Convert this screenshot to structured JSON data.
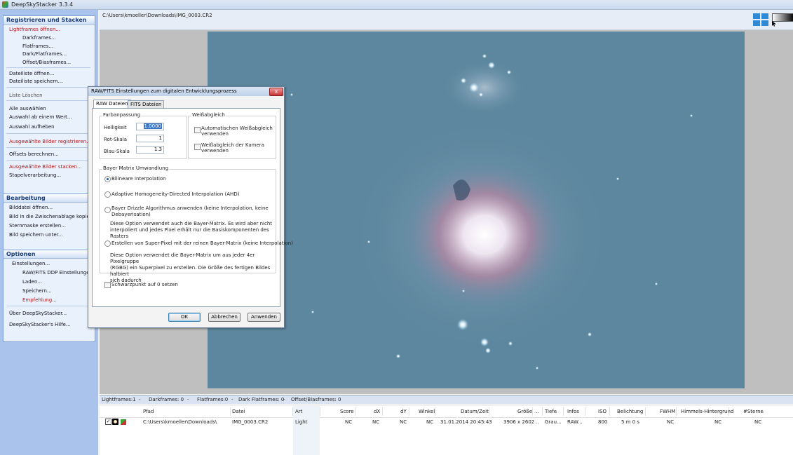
{
  "app": {
    "title": "DeepSkyStacker 3.3.4"
  },
  "sidebar": {
    "register": {
      "header": "Registrieren und Stacken",
      "items": [
        {
          "label": "Lightframes öffnen...",
          "style": "red"
        },
        {
          "label": "Darkframes...",
          "style": "sub"
        },
        {
          "label": "Flatframes...",
          "style": "sub"
        },
        {
          "label": "Dark/Flatframes...",
          "style": "sub"
        },
        {
          "label": "Offset/Biasframes...",
          "style": "sub"
        },
        {
          "label": "Dateiliste öffnen...",
          "style": "normal"
        },
        {
          "label": "Dateiliste speichern...",
          "style": "normal"
        },
        {
          "label": "Liste Löschen",
          "style": "gray"
        },
        {
          "label": "Alle auswählen",
          "style": "normal"
        },
        {
          "label": "Auswahl ab einem Wert...",
          "style": "normal"
        },
        {
          "label": "Auswahl aufheben",
          "style": "normal"
        },
        {
          "label": "Ausgewählte Bilder registrieren...",
          "style": "red"
        },
        {
          "label": "Offsets berechnen...",
          "style": "normal"
        },
        {
          "label": "Ausgewählte Bilder stacken...",
          "style": "red"
        },
        {
          "label": "Stapelverarbeitung...",
          "style": "normal"
        }
      ]
    },
    "edit": {
      "header": "Bearbeitung",
      "items": [
        {
          "label": "Bilddatei öffnen..."
        },
        {
          "label": "Bild in die Zwischenablage kopieren"
        },
        {
          "label": "Sternmaske erstellen..."
        },
        {
          "label": "Bild speichern unter..."
        }
      ]
    },
    "options": {
      "header": "Optionen",
      "items": [
        {
          "label": "Einstellungen...",
          "style": "normal"
        },
        {
          "label": "RAW/FITS DDP Einstellungen...",
          "style": "sub"
        },
        {
          "label": "Laden...",
          "style": "sub"
        },
        {
          "label": "Speichern...",
          "style": "sub"
        },
        {
          "label": "Empfehlung...",
          "style": "red"
        },
        {
          "label": "Über DeepSkyStacker...",
          "style": "normal"
        },
        {
          "label": "DeepSkyStacker's Hilfe...",
          "style": "normal"
        }
      ]
    }
  },
  "pathbar": {
    "path": "C:\\Users\\kmoeller\\Downloads\\IMG_0003.CR2"
  },
  "dialog": {
    "title": "RAW/FITS Einstellungen zum digitalen Entwicklungsprozess",
    "close_label": "x",
    "tabs": [
      "RAW Dateien",
      "FITS Dateien"
    ],
    "farbanpassung": {
      "legend": "Farbanpassung",
      "helligkeit_label": "Helligkeit",
      "helligkeit_value": "1.0000",
      "rot_label": "Rot-Skala",
      "rot_value": "1",
      "blau_label": "Blau-Skala",
      "blau_value": "1.3"
    },
    "weissabgleich": {
      "legend": "Weißabgleich",
      "auto_line1": "Automatischen Weißabgleich",
      "auto_line2": "verwenden",
      "kamera_line1": "Weißabgleich der Kamera",
      "kamera_line2": "verwenden"
    },
    "bayer": {
      "legend": "Bayer Matrix Umwandlung",
      "opt1": "Bilineare Interpolation",
      "opt2": "Adaptive Homogeneity-Directed Interpolation (AHD)",
      "opt3_line1": "Bayer Drizzle Algorithmus anwenden (keine Interpolation, keine",
      "opt3_line2": "Debayerisation)",
      "opt3_desc1": "Diese Option verwendet auch die Bayer-Matrix. Es wird aber nicht",
      "opt3_desc2": "interpoliert und jedes Pixel erhält nur die Basiskomponenten des Rasters",
      "opt4": "Erstellen von Super-Pixel mit der reinen Bayer-Matrix (keine Interpolation)",
      "opt4_desc1": "Diese Option verwendet die Bayer-Matrix um aus jeder 4er Pixelgruppe",
      "opt4_desc2": "(RGBG) ein Superpixel zu erstellen. Die Größe des fertigen Bildes halbiert",
      "opt4_desc3": "sich dadurch"
    },
    "schwarzpunkt": "Schwarzpunkt auf 0 setzen",
    "buttons": {
      "ok": "OK",
      "abbrechen": "Abbrechen",
      "anwenden": "Anwenden"
    }
  },
  "status": {
    "lightframes": "Lightframes:1",
    "sep1": "-",
    "darkframes": "Darkframes: 0",
    "sep2": "-",
    "flatframes": "Flatframes:0",
    "sep3": "-",
    "darkflat": "Dark Flatframes: 0",
    "sep4": "-",
    "offset": "Offset/Biasframes: 0"
  },
  "table": {
    "columns": [
      "Pfad",
      "Datei",
      "Art",
      "Score",
      "dX",
      "dY",
      "Winkel",
      "Datum/Zeit",
      "Größe",
      "..",
      "Tiefe",
      "Infos",
      "ISO",
      "Belichtung",
      "FWHM",
      "Himmels-Hintergrund",
      "#Sterne"
    ],
    "rows": [
      {
        "pfad": "C:\\Users\\kmoeller\\Downloads\\",
        "datei": "IMG_0003.CR2",
        "art": "Light",
        "score": "NC",
        "dx": "NC",
        "dy": "NC",
        "winkel": "NC",
        "datum": "31.01.2014 20:45:43",
        "groesse": "3906 x 2602",
        "dots": "..",
        "tiefe": "Grau...",
        "infos": "RAW...",
        "iso": "800",
        "belichtung": "5 m 0 s",
        "fwhm": "NC",
        "himmel": "NC",
        "sterne": "NC"
      }
    ]
  },
  "colors": {
    "sidebar_bg": "#a9c3ec",
    "accent_red": "#b8161a",
    "selection": "#3a75c4"
  }
}
